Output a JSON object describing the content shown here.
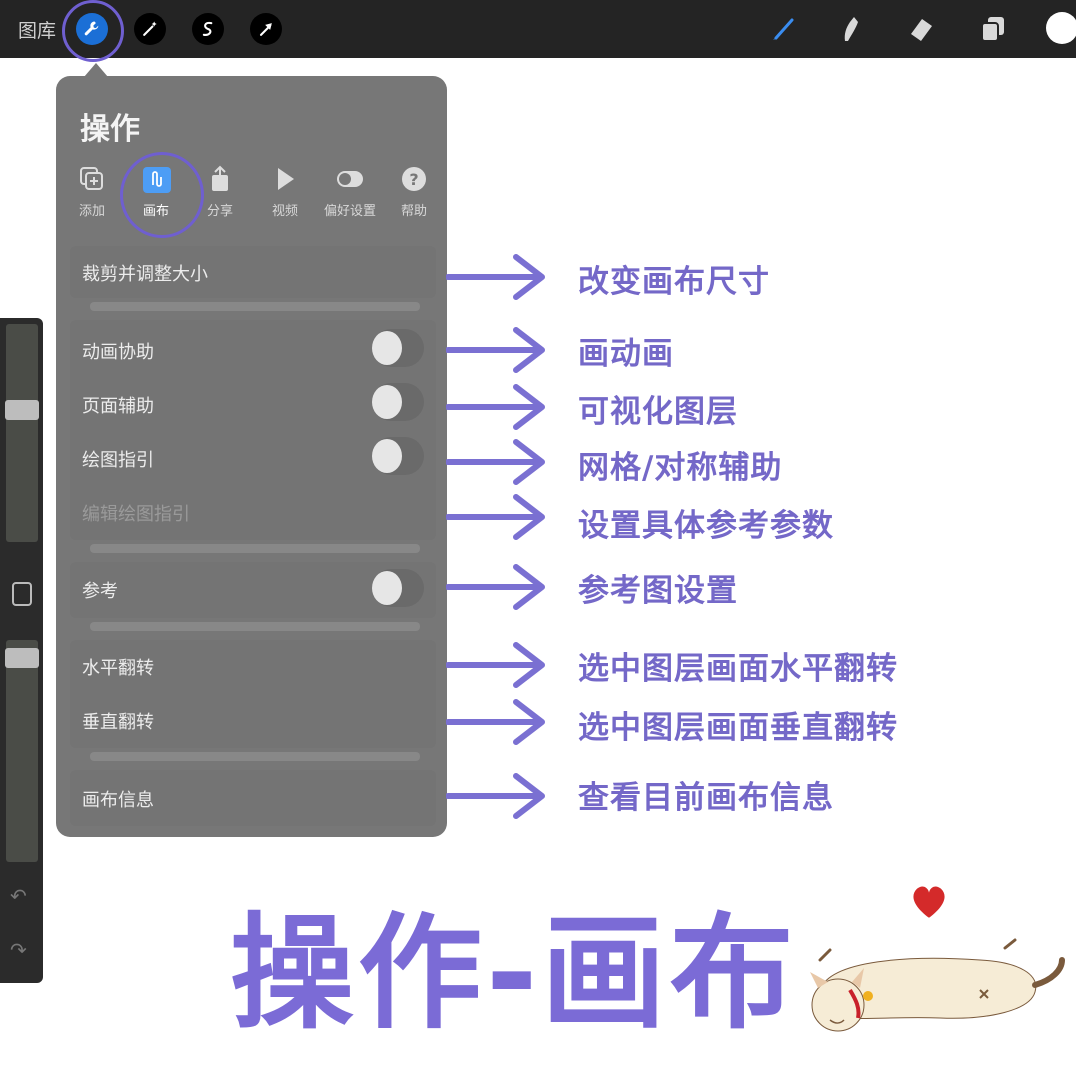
{
  "toolbar": {
    "gallery_label": "图库",
    "icons": [
      "wrench-icon",
      "magic-wand-icon",
      "selection-icon",
      "move-arrow-icon",
      "brush-icon",
      "smudge-icon",
      "eraser-icon",
      "layers-icon",
      "color-icon"
    ],
    "accent_color": "#1b6fd6"
  },
  "panel": {
    "title": "操作",
    "tabs": [
      {
        "label": "添加",
        "icon": "add-icon"
      },
      {
        "label": "画布",
        "icon": "canvas-icon",
        "selected": true
      },
      {
        "label": "分享",
        "icon": "share-icon"
      },
      {
        "label": "视频",
        "icon": "video-icon"
      },
      {
        "label": "偏好设置",
        "icon": "toggle-icon"
      },
      {
        "label": "帮助",
        "icon": "help-icon"
      }
    ],
    "rows": {
      "crop": "裁剪并调整大小",
      "animation": "动画协助",
      "page": "页面辅助",
      "guide": "绘图指引",
      "edit_guide": "编辑绘图指引",
      "reference": "参考",
      "flip_h": "水平翻转",
      "flip_v": "垂直翻转",
      "info": "画布信息"
    },
    "toggles": {
      "animation": false,
      "page": false,
      "guide": false,
      "reference": false
    }
  },
  "annotations": [
    "改变画布尺寸",
    "画动画",
    "可视化图层",
    "网格/对称辅助",
    "设置具体参考参数",
    "参考图设置",
    "选中图层画面水平翻转",
    "选中图层画面垂直翻转",
    "查看目前画布信息"
  ],
  "big_title": "操作-画布",
  "colors": {
    "annotation": "#7468c8",
    "title": "#7b6bd6",
    "heart": "#d42a2a"
  }
}
